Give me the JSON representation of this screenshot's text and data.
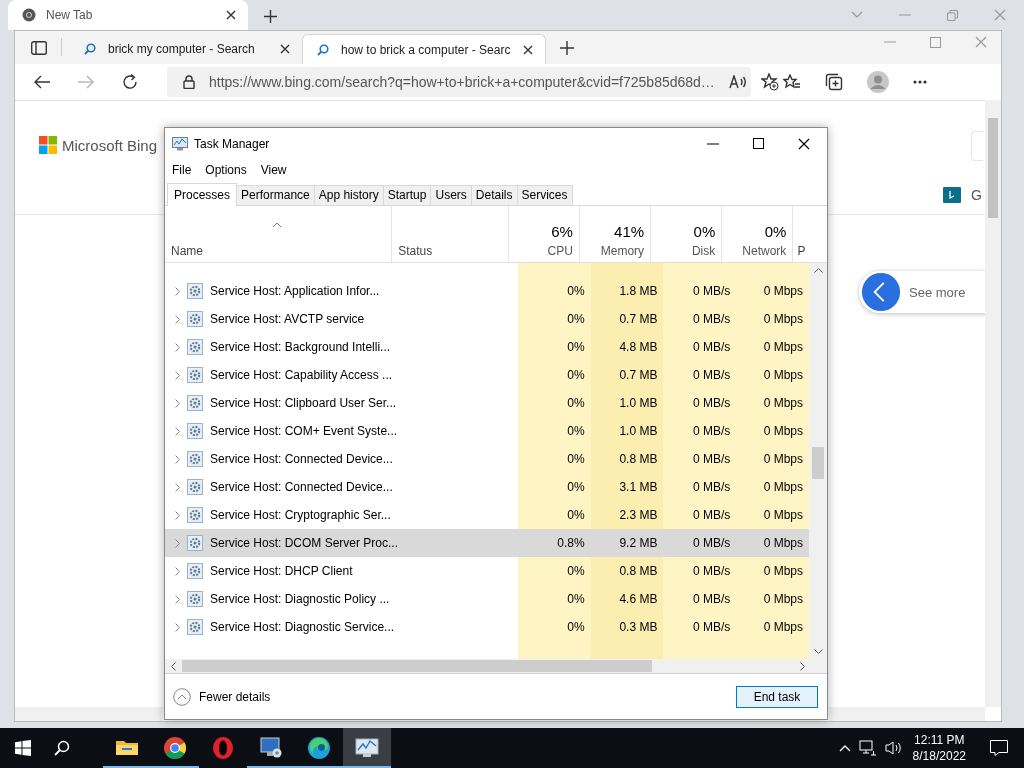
{
  "back_browser": {
    "tab_title": "New Tab"
  },
  "browser": {
    "tabs": [
      {
        "title": "brick my computer - Search",
        "selected": false
      },
      {
        "title": "how to brick a computer - Searc",
        "selected": true
      }
    ],
    "address": "https://www.bing.com/search?q=how+to+brick+a+computer&cvid=f725b85d68d…"
  },
  "page": {
    "logo": "Microsoft Bing",
    "side_link": "G",
    "see_more": "See more"
  },
  "task_manager": {
    "title": "Task Manager",
    "menu": [
      "File",
      "Options",
      "View"
    ],
    "tabs": [
      {
        "label": "Processes",
        "selected": true
      },
      {
        "label": "Performance",
        "selected": false
      },
      {
        "label": "App history",
        "selected": false
      },
      {
        "label": "Startup",
        "selected": false
      },
      {
        "label": "Users",
        "selected": false
      },
      {
        "label": "Details",
        "selected": false
      },
      {
        "label": "Services",
        "selected": false
      }
    ],
    "columns": [
      {
        "label": "Name"
      },
      {
        "label": "Status"
      },
      {
        "label": "CPU",
        "total": "6%"
      },
      {
        "label": "Memory",
        "total": "41%"
      },
      {
        "label": "Disk",
        "total": "0%"
      },
      {
        "label": "Network",
        "total": "0%"
      },
      {
        "label": "P"
      }
    ],
    "rows": [
      {
        "kind": "service",
        "name": "Service Host: Application Infor...",
        "cpu": "0%",
        "memory": "1.8 MB",
        "disk": "0 MB/s",
        "network": "0 Mbps",
        "selected": false
      },
      {
        "kind": "service",
        "name": "Service Host: AVCTP service",
        "cpu": "0%",
        "memory": "0.7 MB",
        "disk": "0 MB/s",
        "network": "0 Mbps",
        "selected": false
      },
      {
        "kind": "service",
        "name": "Service Host: Background Intelli...",
        "cpu": "0%",
        "memory": "4.8 MB",
        "disk": "0 MB/s",
        "network": "0 Mbps",
        "selected": false
      },
      {
        "kind": "service",
        "name": "Service Host: Capability Access ...",
        "cpu": "0%",
        "memory": "0.7 MB",
        "disk": "0 MB/s",
        "network": "0 Mbps",
        "selected": false
      },
      {
        "kind": "service",
        "name": "Service Host: Clipboard User Ser...",
        "cpu": "0%",
        "memory": "1.0 MB",
        "disk": "0 MB/s",
        "network": "0 Mbps",
        "selected": false
      },
      {
        "kind": "service",
        "name": "Service Host: COM+ Event Syste...",
        "cpu": "0%",
        "memory": "1.0 MB",
        "disk": "0 MB/s",
        "network": "0 Mbps",
        "selected": false
      },
      {
        "kind": "service",
        "name": "Service Host: Connected Device...",
        "cpu": "0%",
        "memory": "0.8 MB",
        "disk": "0 MB/s",
        "network": "0 Mbps",
        "selected": false
      },
      {
        "kind": "service",
        "name": "Service Host: Connected Device...",
        "cpu": "0%",
        "memory": "3.1 MB",
        "disk": "0 MB/s",
        "network": "0 Mbps",
        "selected": false
      },
      {
        "kind": "service",
        "name": "Service Host: Cryptographic Ser...",
        "cpu": "0%",
        "memory": "2.3 MB",
        "disk": "0 MB/s",
        "network": "0 Mbps",
        "selected": false
      },
      {
        "kind": "service",
        "name": "Service Host: DCOM Server Proc...",
        "cpu": "0.8%",
        "memory": "9.2 MB",
        "disk": "0 MB/s",
        "network": "0 Mbps",
        "selected": true
      },
      {
        "kind": "service",
        "name": "Service Host: DHCP Client",
        "cpu": "0%",
        "memory": "0.8 MB",
        "disk": "0 MB/s",
        "network": "0 Mbps",
        "selected": false
      },
      {
        "kind": "service",
        "name": "Service Host: Diagnostic Policy ...",
        "cpu": "0%",
        "memory": "4.6 MB",
        "disk": "0 MB/s",
        "network": "0 Mbps",
        "selected": false
      },
      {
        "kind": "service",
        "name": "Service Host: Diagnostic Service...",
        "cpu": "0%",
        "memory": "0.3 MB",
        "disk": "0 MB/s",
        "network": "0 Mbps",
        "selected": false
      }
    ],
    "fewer_details": "Fewer details",
    "end_task": "End task"
  },
  "taskbar": {
    "apps": [
      {
        "kind": "explorer",
        "running": true,
        "active": false
      },
      {
        "kind": "chrome",
        "running": true,
        "active": false
      },
      {
        "kind": "opera",
        "running": false,
        "active": false
      },
      {
        "kind": "remote",
        "running": true,
        "active": false
      },
      {
        "kind": "edge",
        "running": true,
        "active": false
      },
      {
        "kind": "taskmgr",
        "running": true,
        "active": true
      }
    ],
    "time": "12:11 PM",
    "date": "8/18/2022"
  }
}
